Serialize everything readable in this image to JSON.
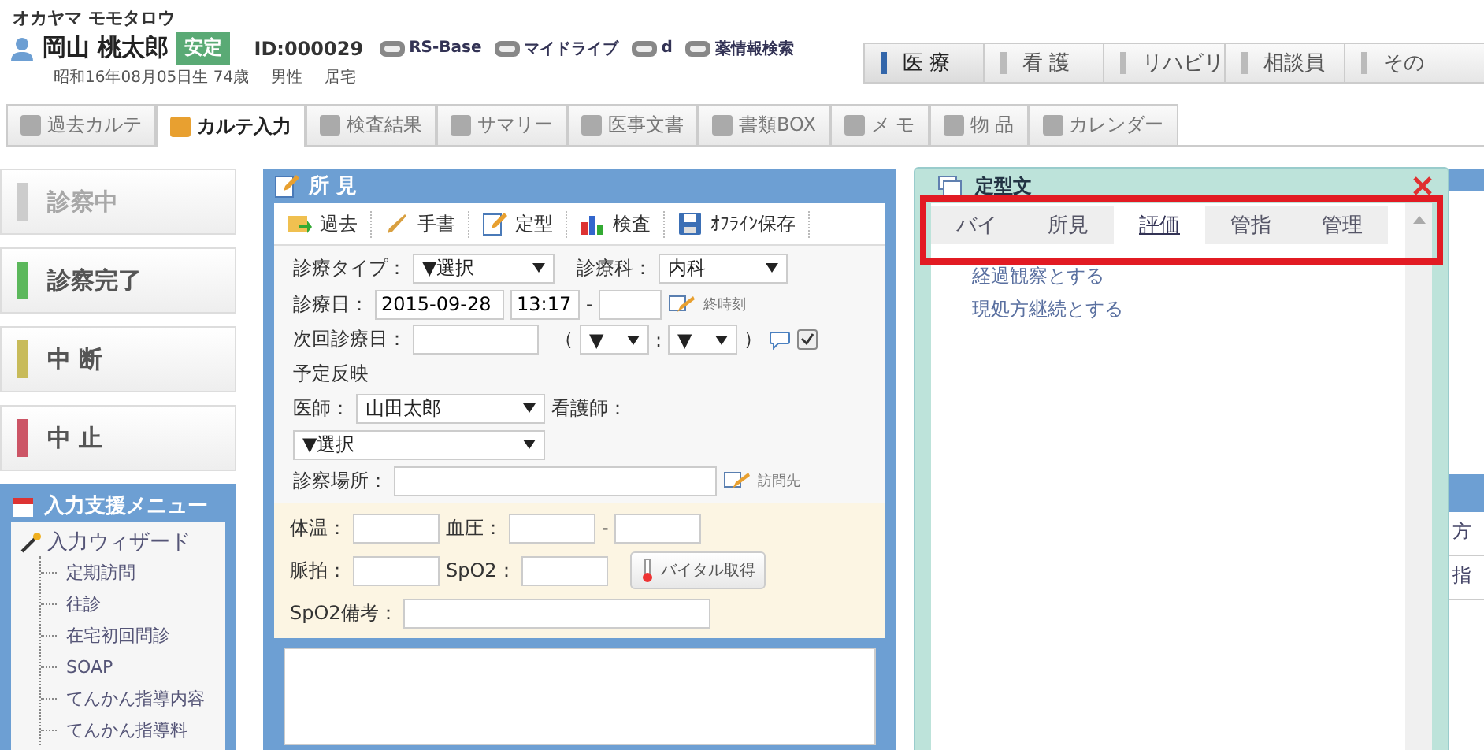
{
  "patient": {
    "kana": "オカヤマ モモタロウ",
    "name": "岡山 桃太郎",
    "status_badge": "安定",
    "id": "ID:000029",
    "birth": "昭和16年08月05日生 74歳",
    "sex": "男性",
    "residence": "居宅"
  },
  "links": [
    "RS-Base",
    "マイドライブ",
    "d",
    "薬情報検索"
  ],
  "role_tabs": [
    {
      "label": "医 療",
      "selected": true
    },
    {
      "label": "看 護",
      "selected": false
    },
    {
      "label": "リハビリ",
      "selected": false
    },
    {
      "label": "相談員",
      "selected": false
    },
    {
      "label": "その",
      "selected": false
    }
  ],
  "page_tabs": [
    {
      "label": "過去カルテ",
      "selected": false
    },
    {
      "label": "カルテ入力",
      "selected": true
    },
    {
      "label": "検査結果",
      "selected": false
    },
    {
      "label": "サマリー",
      "selected": false
    },
    {
      "label": "医事文書",
      "selected": false
    },
    {
      "label": "書類BOX",
      "selected": false
    },
    {
      "label": "メ モ",
      "selected": false
    },
    {
      "label": "物 品",
      "selected": false
    },
    {
      "label": "カレンダー",
      "selected": false
    }
  ],
  "status_buttons": [
    {
      "label": "診察中",
      "color": "#cccccc",
      "disabled": true
    },
    {
      "label": "診察完了",
      "color": "#5cb85c",
      "disabled": false
    },
    {
      "label": "中 断",
      "color": "#c8bb5a",
      "disabled": false
    },
    {
      "label": "中 止",
      "color": "#cc5566",
      "disabled": false
    }
  ],
  "support_menu": {
    "title": "入力支援メニュー",
    "items": [
      {
        "label": "入力ウィザード",
        "children": [
          {
            "label": "定期訪問"
          },
          {
            "label": "往診"
          },
          {
            "label": "在宅初回問診"
          },
          {
            "label": "SOAP"
          },
          {
            "label": "てんかん指導内容"
          },
          {
            "label": "てんかん指導料"
          }
        ]
      }
    ]
  },
  "findings_panel": {
    "title": "所 見",
    "toolbar": [
      "過去",
      "手書",
      "定型",
      "検査",
      "ｵﾌﾗｲﾝ保存"
    ],
    "form": {
      "type_label": "診療タイプ：",
      "type_value": "▼選択",
      "dept_label": "診療科：",
      "dept_value": "内科",
      "date_label": "診療日：",
      "date_value": "2015-09-28",
      "time_start": "13:17",
      "time_separator": "-",
      "end_time_link": "終時刻",
      "next_label": "次回診療日：",
      "paren_open": "（",
      "next_hour": "▼",
      "time_colon": ":",
      "next_minute": "▼",
      "paren_close": "）",
      "reflect_label": "予定反映",
      "reflect_checked": true,
      "doctor_label": "医師：",
      "doctor_value": "山田太郎",
      "nurse_label": "看護師：",
      "nurse_value": "▼選択",
      "place_label": "診察場所：",
      "visit_link": "訪問先"
    },
    "vitals": {
      "temp_label": "体温：",
      "bp_label": "血圧：",
      "bp_separator": "-",
      "pulse_label": "脈拍：",
      "spo2_label": "SpO2：",
      "vital_button": "バイタル取得",
      "spo2_note_label": "SpO2備考："
    }
  },
  "template_dialog": {
    "title": "定型文",
    "tabs": [
      {
        "label": "バイ",
        "selected": false
      },
      {
        "label": "所見",
        "selected": false
      },
      {
        "label": "評価",
        "selected": true
      },
      {
        "label": "管指",
        "selected": false
      },
      {
        "label": "管理",
        "selected": false
      }
    ],
    "items": [
      "経過観察とする",
      "現処方継続とする"
    ]
  },
  "background_fragments": [
    "方",
    "指"
  ]
}
